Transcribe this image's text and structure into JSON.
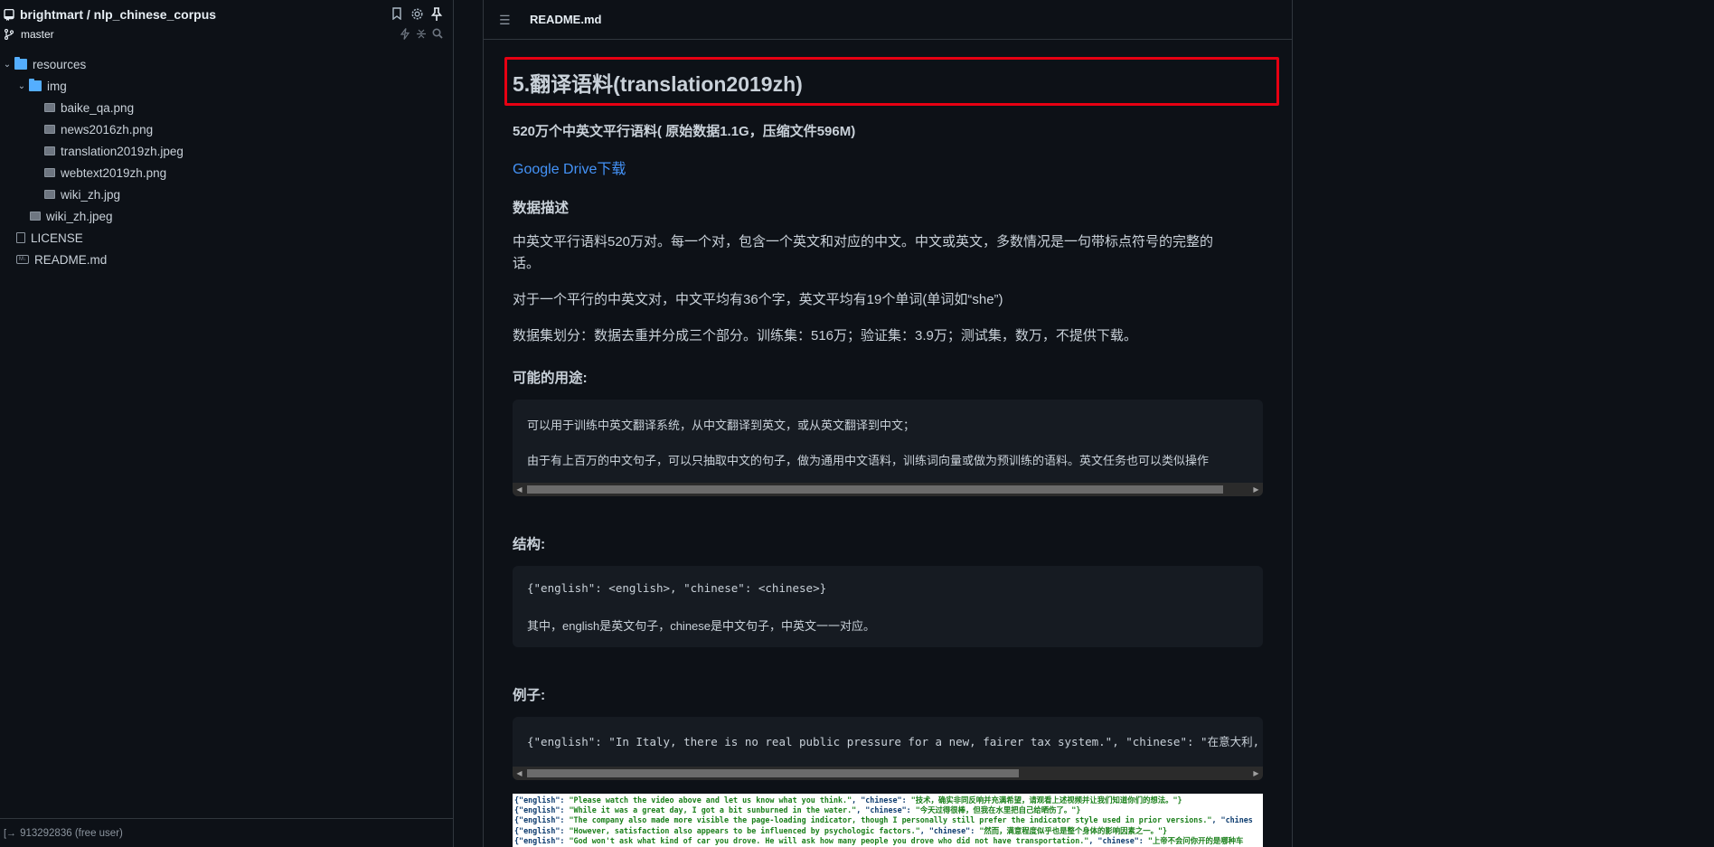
{
  "sidebar": {
    "repo": "brightmart / nlp_chinese_corpus",
    "branch": "master",
    "tree": [
      {
        "label": "resources",
        "type": "folder",
        "level": 0,
        "expanded": true
      },
      {
        "label": "img",
        "type": "folder",
        "level": 1,
        "expanded": true
      },
      {
        "label": "baike_qa.png",
        "type": "image",
        "level": 2
      },
      {
        "label": "news2016zh.png",
        "type": "image",
        "level": 2
      },
      {
        "label": "translation2019zh.jpeg",
        "type": "image",
        "level": 2
      },
      {
        "label": "webtext2019zh.png",
        "type": "image",
        "level": 2
      },
      {
        "label": "wiki_zh.jpg",
        "type": "image",
        "level": 2
      },
      {
        "label": "wiki_zh.jpeg",
        "type": "image",
        "level": 1
      },
      {
        "label": "LICENSE",
        "type": "file",
        "level": 0
      },
      {
        "label": "README.md",
        "type": "markdown",
        "level": 0
      }
    ],
    "footer_user": "913292836 (free user)"
  },
  "main": {
    "file_name": "README.md",
    "heading": "5.翻译语料(translation2019zh)",
    "summary": "520万个中英文平行语料( 原始数据1.1G，压缩文件596M)",
    "download_link": "Google Drive下载",
    "desc_heading": "数据描述",
    "desc_p1_line1": "中英文平行语料520万对。每一个对，包含一个英文和对应的中文。中文或英文，多数情况是一句带标点符号的完整的",
    "desc_p1_line2": "话。",
    "desc_p2": "对于一个平行的中英文对，中文平均有36个字，英文平均有19个单词(单词如“she”)",
    "desc_p3": "数据集划分：数据去重并分成三个部分。训练集：516万；验证集：3.9万；测试集，数万，不提供下载。",
    "usage_heading": "可能的用途:",
    "usage_line1": "可以用于训练中英文翻译系统，从中文翻译到英文，或从英文翻译到中文；",
    "usage_line2": "由于有上百万的中文句子，可以只抽取中文的句子，做为通用中文语料，训练词向量或做为预训练的语料。英文任务也可以类似操作",
    "structure_heading": "结构:",
    "structure_line1": "{\"english\": <english>, \"chinese\": <chinese>}",
    "structure_line2": "其中，english是英文句子，chinese是中文句子，中英文一一对应。",
    "example_heading": "例子:",
    "example_line": "{\"english\": \"In Italy, there is no real public pressure for a new, fairer tax system.\", \"chinese\": \"在意大利,",
    "sample_lines": [
      {
        "pre": "{\"english\": ",
        "en": "\"Please watch the video above and let us know what you think.\"",
        "mid": ", \"chinese\": ",
        "zh": "\"技术，确实非同反响并充满希望，请观看上述视频并让我们知道你们的想法。\"}"
      },
      {
        "pre": "{\"english\": ",
        "en": "\"While it was a great day, I got a bit sunburned in the water.\"",
        "mid": ", \"chinese\": ",
        "zh": "\"今天过得很棒，但我在水里把自己给晒伤了。\"}"
      },
      {
        "pre": "{\"english\": ",
        "en": "\"The company also made more visible the page-loading indicator, though I personally still prefer the indicator style used in prior versions.\"",
        "mid": ", \"chines",
        "zh": ""
      },
      {
        "pre": "{\"english\": ",
        "en": "\"However, satisfaction also appears to be influenced by psychologic factors.\"",
        "mid": ", \"chinese\": ",
        "zh": "\"然而，满意程度似乎也是整个身体的影响因素之一。\"}"
      },
      {
        "pre": "{\"english\": ",
        "en": "\"God won't ask what kind of car you drove. He will ask how many people you drove who did not have  transportation.\"",
        "mid": ", \"chinese\": ",
        "zh": "\"上帝不会问你开的是哪种车"
      }
    ]
  },
  "colors": {
    "background": "#0d1117",
    "text": "#c9d1d9",
    "link": "#4493f8",
    "highlight_box": "#e60012",
    "code_bg": "#161b22"
  }
}
